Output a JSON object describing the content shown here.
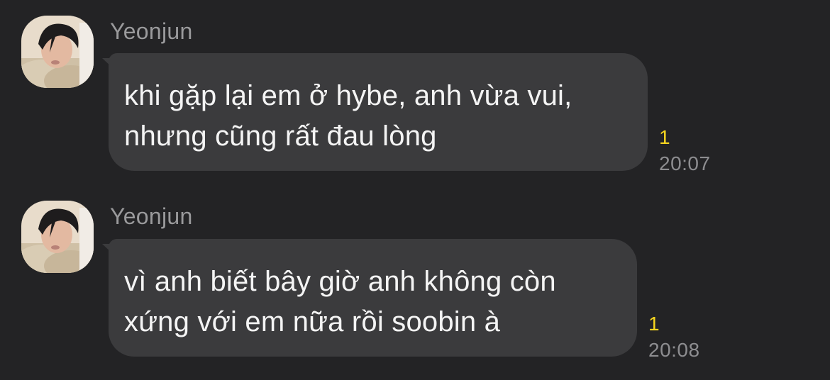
{
  "messages": [
    {
      "sender": "Yeonjun",
      "text": "khi gặp lại em ở hybe, anh vừa vui,\nnhưng cũng rất đau lòng",
      "unread": "1",
      "time": "20:07"
    },
    {
      "sender": "Yeonjun",
      "text": "vì anh biết bây giờ anh không còn\nxứng với em nữa rồi soobin à",
      "unread": "1",
      "time": "20:08"
    }
  ],
  "colors": {
    "background": "#232325",
    "bubble": "#3b3b3d",
    "unread": "#f6d51f",
    "sender": "#9a9a9c"
  },
  "icons": {
    "avatar": "profile-photo"
  }
}
